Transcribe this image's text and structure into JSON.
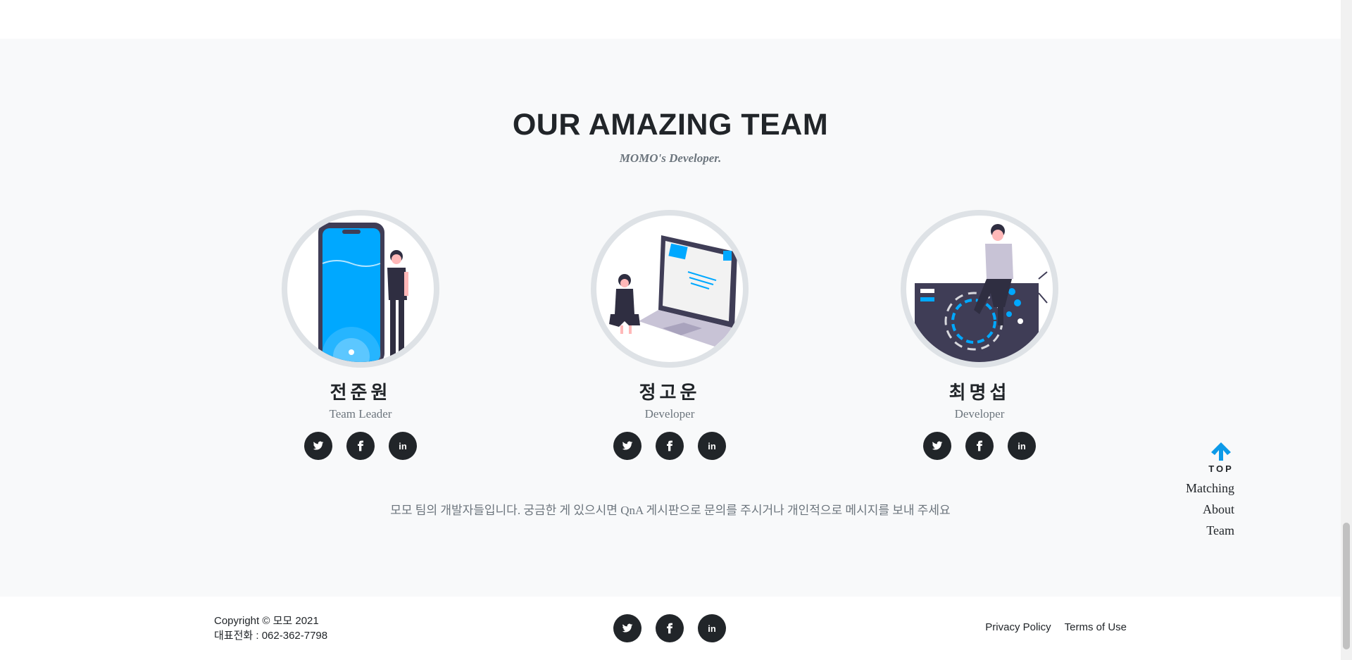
{
  "team": {
    "title": "OUR AMAZING TEAM",
    "subtitle": "MOMO's Developer.",
    "members": [
      {
        "name": "전준원",
        "role": "Team Leader"
      },
      {
        "name": "정고운",
        "role": "Developer"
      },
      {
        "name": "최명섭",
        "role": "Developer"
      }
    ],
    "social_icons": [
      "twitter-icon",
      "facebook-icon",
      "linkedin-icon"
    ],
    "note": "모모 팀의 개발자들입니다. 궁금한 게 있으시면 QnA 게시판으로 문의를 주시거나 개인적으로 메시지를 보내 주세요"
  },
  "scroll_top": {
    "label": "TOP"
  },
  "side_nav": {
    "items": [
      "Matching",
      "About",
      "Team"
    ]
  },
  "footer": {
    "copyright": "Copyright © 모모 2021",
    "phone": "대표전화 : 062-362-7798",
    "links": [
      "Privacy Policy",
      "Terms of Use"
    ]
  },
  "colors": {
    "accent": "#0d9ae8",
    "dark": "#212529",
    "muted": "#6c757d",
    "section_bg": "#f8f9fa"
  }
}
